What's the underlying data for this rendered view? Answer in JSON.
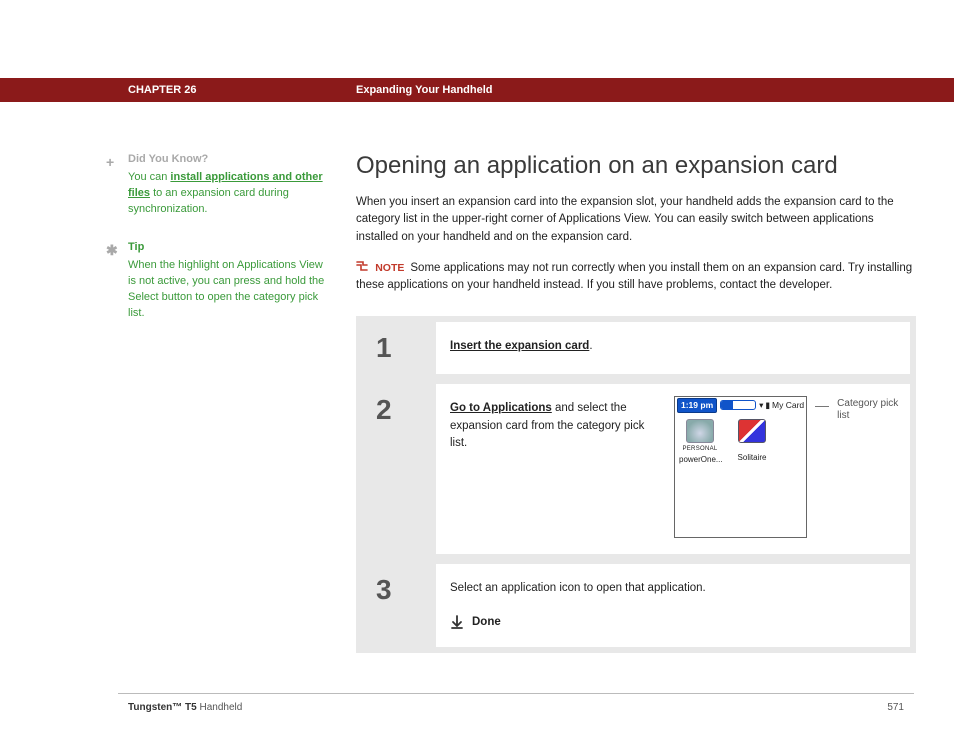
{
  "header": {
    "chapter": "CHAPTER 26",
    "title": "Expanding Your Handheld"
  },
  "sidebar": {
    "dyk": {
      "heading": "Did You Know?",
      "pre": "You can ",
      "link": "install applications and other files",
      "post": " to an expansion card during synchronization."
    },
    "tip": {
      "heading": "Tip",
      "text": "When the highlight on Applications View is not active, you can press and hold the Select button to open the category pick list."
    }
  },
  "main": {
    "h1": "Opening an application on an expansion card",
    "intro": "When you insert an expansion card into the expansion slot, your handheld adds the expansion card to the category list in the upper-right corner of Applications View. You can easily switch between applications installed on your handheld and on the expansion card.",
    "note_label": "NOTE",
    "note_text": "Some applications may not run correctly when you install them on an expansion card. Try installing these applications on your handheld instead. If you still have problems, contact the developer."
  },
  "steps": [
    {
      "num": "1",
      "link": "Insert the expansion card",
      "post": "."
    },
    {
      "num": "2",
      "link": "Go to Applications",
      "post": " and select the expansion card from the category pick list.",
      "screenshot": {
        "time": "1:19 pm",
        "category": "My Card",
        "apps": [
          {
            "sub": "PERSONAL",
            "name": "powerOne..."
          },
          {
            "sub": "",
            "name": "Solitaire"
          }
        ],
        "callout": "Category pick list"
      }
    },
    {
      "num": "3",
      "text": "Select an application icon to open that application.",
      "done": "Done"
    }
  ],
  "footer": {
    "product_bold": "Tungsten™ T5",
    "product_rest": " Handheld",
    "page": "571"
  }
}
